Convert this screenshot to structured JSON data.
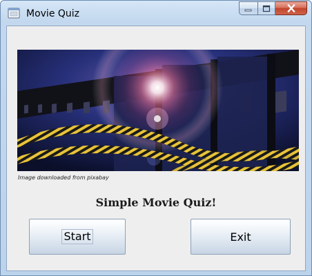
{
  "window": {
    "title": "Movie Quiz"
  },
  "banner": {
    "caption": "Image downloaded from pixabay"
  },
  "main": {
    "heading": "Simple Movie Quiz!"
  },
  "buttons": {
    "start_label": "Start",
    "exit_label": "Exit"
  },
  "icons": {
    "app": "java-app-icon",
    "minimize": "minimize-icon",
    "maximize": "maximize-icon",
    "close": "close-icon"
  },
  "colors": {
    "titlebar": "#c3d8ee",
    "client_background": "#eeeeee",
    "close_button": "#c0452c"
  }
}
